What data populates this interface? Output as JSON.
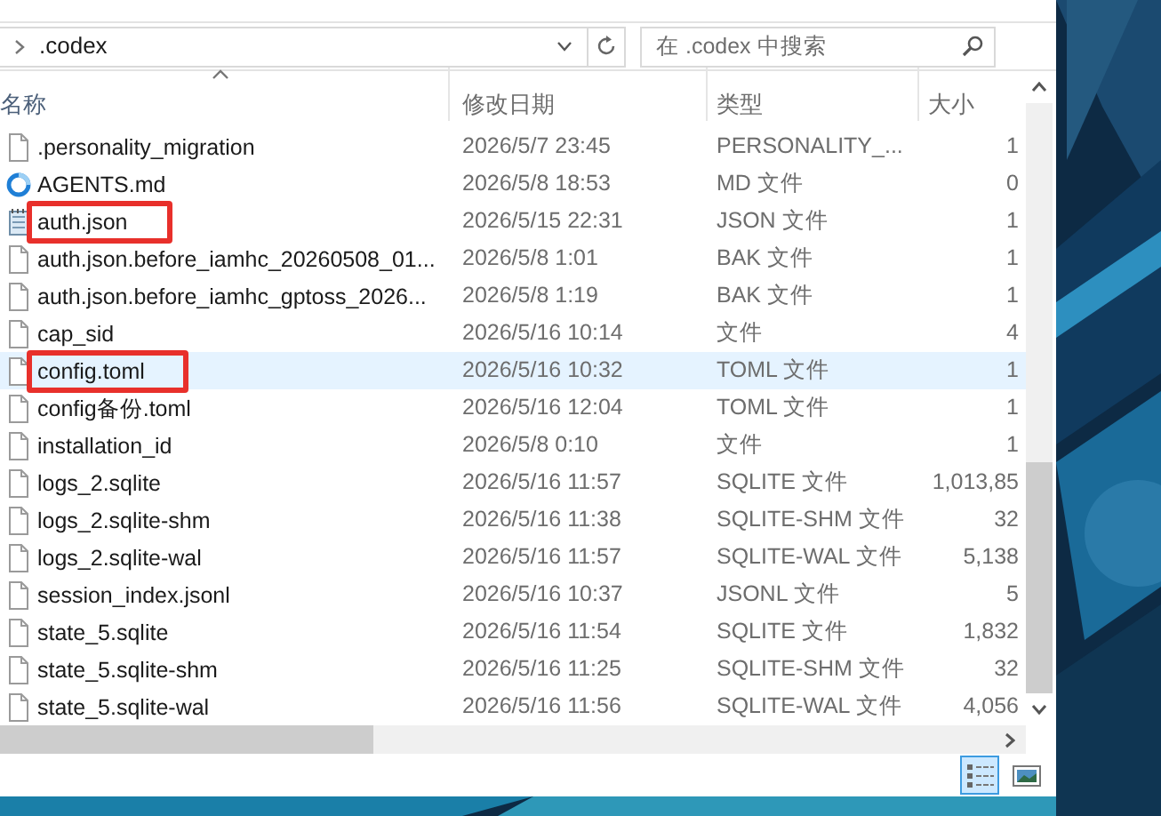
{
  "address_bar": {
    "path": ".codex"
  },
  "search": {
    "placeholder": "在 .codex 中搜索"
  },
  "table": {
    "columns": [
      "名称",
      "修改日期",
      "类型",
      "大小"
    ],
    "rows": [
      {
        "kind": "file",
        "name": ".personality_migration",
        "date": "2026/5/7 23:45",
        "type": "PERSONALITY_...",
        "size": "1",
        "selected": false,
        "highlighted": false
      },
      {
        "kind": "sync",
        "name": "AGENTS.md",
        "date": "2026/5/8 18:53",
        "type": "MD 文件",
        "size": "0",
        "selected": false,
        "highlighted": false
      },
      {
        "kind": "notepad",
        "name": "auth.json",
        "date": "2026/5/15 22:31",
        "type": "JSON 文件",
        "size": "1",
        "selected": false,
        "highlighted": true
      },
      {
        "kind": "file",
        "name": "auth.json.before_iamhc_20260508_01...",
        "date": "2026/5/8 1:01",
        "type": "BAK 文件",
        "size": "1",
        "selected": false,
        "highlighted": false
      },
      {
        "kind": "file",
        "name": "auth.json.before_iamhc_gptoss_2026...",
        "date": "2026/5/8 1:19",
        "type": "BAK 文件",
        "size": "1",
        "selected": false,
        "highlighted": false
      },
      {
        "kind": "file",
        "name": "cap_sid",
        "date": "2026/5/16 10:14",
        "type": "文件",
        "size": "4",
        "selected": false,
        "highlighted": false
      },
      {
        "kind": "file",
        "name": "config.toml",
        "date": "2026/5/16 10:32",
        "type": "TOML 文件",
        "size": "1",
        "selected": true,
        "highlighted": true
      },
      {
        "kind": "file",
        "name": "config备份.toml",
        "date": "2026/5/16 12:04",
        "type": "TOML 文件",
        "size": "1",
        "selected": false,
        "highlighted": false
      },
      {
        "kind": "file",
        "name": "installation_id",
        "date": "2026/5/8 0:10",
        "type": "文件",
        "size": "1",
        "selected": false,
        "highlighted": false
      },
      {
        "kind": "file",
        "name": "logs_2.sqlite",
        "date": "2026/5/16 11:57",
        "type": "SQLITE 文件",
        "size": "1,013,85",
        "selected": false,
        "highlighted": false
      },
      {
        "kind": "file",
        "name": "logs_2.sqlite-shm",
        "date": "2026/5/16 11:38",
        "type": "SQLITE-SHM 文件",
        "size": "32",
        "selected": false,
        "highlighted": false
      },
      {
        "kind": "file",
        "name": "logs_2.sqlite-wal",
        "date": "2026/5/16 11:57",
        "type": "SQLITE-WAL 文件",
        "size": "5,138",
        "selected": false,
        "highlighted": false
      },
      {
        "kind": "file",
        "name": "session_index.jsonl",
        "date": "2026/5/16 10:37",
        "type": "JSONL 文件",
        "size": "5",
        "selected": false,
        "highlighted": false
      },
      {
        "kind": "file",
        "name": "state_5.sqlite",
        "date": "2026/5/16 11:54",
        "type": "SQLITE 文件",
        "size": "1,832",
        "selected": false,
        "highlighted": false
      },
      {
        "kind": "file",
        "name": "state_5.sqlite-shm",
        "date": "2026/5/16 11:25",
        "type": "SQLITE-SHM 文件",
        "size": "32",
        "selected": false,
        "highlighted": false
      },
      {
        "kind": "file",
        "name": "state_5.sqlite-wal",
        "date": "2026/5/16 11:56",
        "type": "SQLITE-WAL 文件",
        "size": "4,056",
        "selected": false,
        "highlighted": false
      }
    ]
  },
  "view_buttons": [
    {
      "kind": "details",
      "selected": true
    },
    {
      "kind": "thumbnails",
      "selected": false
    }
  ]
}
